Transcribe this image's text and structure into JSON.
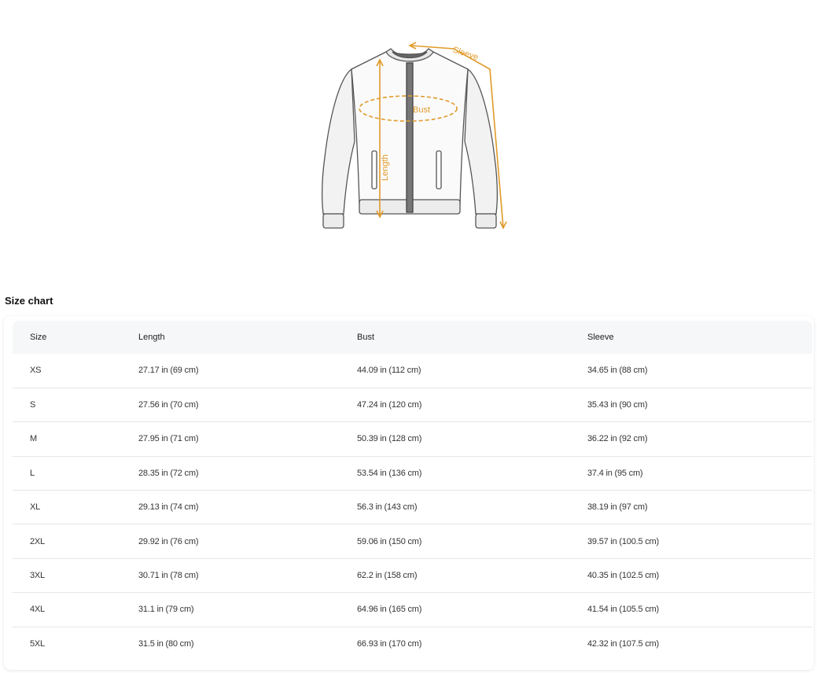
{
  "illustration": {
    "labels": {
      "sleeve": "Sleeve",
      "bust": "Bust",
      "length": "Length"
    },
    "accent_color": "#e09a2a"
  },
  "size_chart": {
    "title": "Size chart",
    "columns": [
      "Size",
      "Length",
      "Bust",
      "Sleeve"
    ],
    "rows": [
      [
        "XS",
        "27.17 in  (69 cm)",
        "44.09 in  (112 cm)",
        "34.65 in  (88 cm)"
      ],
      [
        "S",
        "27.56 in  (70 cm)",
        "47.24 in  (120 cm)",
        "35.43 in  (90 cm)"
      ],
      [
        "M",
        "27.95 in  (71 cm)",
        "50.39 in  (128 cm)",
        "36.22 in  (92 cm)"
      ],
      [
        "L",
        "28.35 in  (72 cm)",
        "53.54 in  (136 cm)",
        "37.4 in  (95 cm)"
      ],
      [
        "XL",
        "29.13 in  (74 cm)",
        "56.3 in  (143 cm)",
        "38.19 in  (97 cm)"
      ],
      [
        "2XL",
        "29.92 in  (76 cm)",
        "59.06 in  (150 cm)",
        "39.57 in  (100.5 cm)"
      ],
      [
        "3XL",
        "30.71 in  (78 cm)",
        "62.2 in  (158 cm)",
        "40.35 in  (102.5 cm)"
      ],
      [
        "4XL",
        "31.1 in  (79 cm)",
        "64.96 in  (165 cm)",
        "41.54 in  (105.5 cm)"
      ],
      [
        "5XL",
        "31.5 in  (80 cm)",
        "66.93 in  (170 cm)",
        "42.32 in  (107.5 cm)"
      ]
    ]
  }
}
